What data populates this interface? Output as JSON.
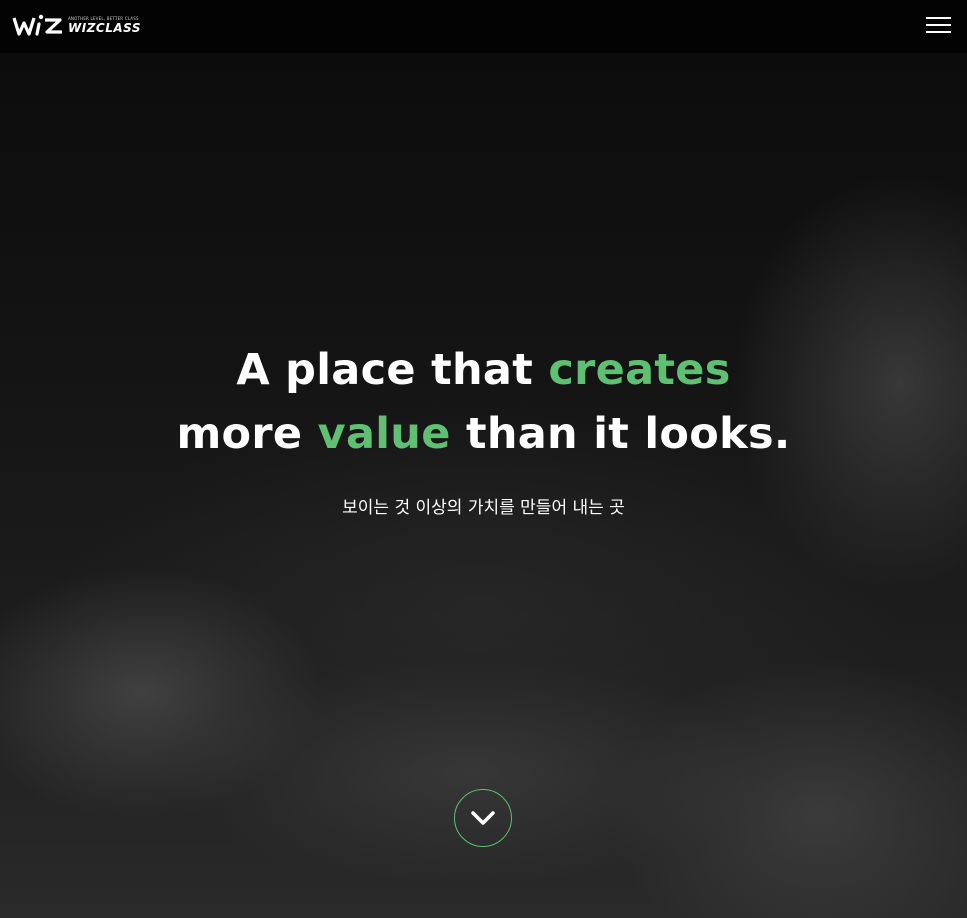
{
  "header": {
    "logo_mark": "WiZ",
    "logo_tagline": "ANOTHER LEVEL, BETTER CLASS",
    "logo_brand": "WIZCLASS",
    "menu_icon": "hamburger-menu-icon"
  },
  "hero": {
    "headline_line1_prefix": "A place that ",
    "headline_line1_accent": "creates",
    "headline_line2_prefix": "more ",
    "headline_line2_accent": "value",
    "headline_line2_suffix": " than it looks.",
    "subtitle": "보이는 것 이상의 가치를 만들어 내는 곳",
    "scroll_icon": "chevron-down-icon"
  },
  "colors": {
    "header_bg": "#030303",
    "accent": "#5fbf73",
    "text": "#ffffff"
  }
}
